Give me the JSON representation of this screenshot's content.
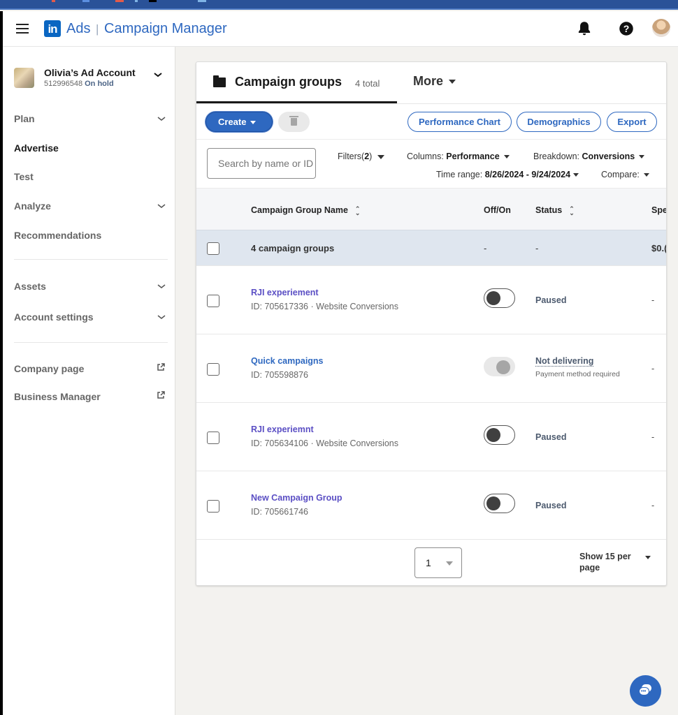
{
  "os_bar": {
    "accent_colors": [
      "#e25b4a",
      "#5b8fe0",
      "#e25b4a",
      "#7fb4e6",
      "#000000",
      "#7fb4e6"
    ]
  },
  "header": {
    "logo_text": "in",
    "app_name": "Ads",
    "separator": "|",
    "product_name": "Campaign Manager",
    "icons": [
      "hamburger-icon",
      "bell-icon",
      "help-icon",
      "avatar"
    ]
  },
  "account": {
    "name": "Olivia’s Ad Account",
    "id": "512996548",
    "status": "On hold"
  },
  "sidebar": {
    "items": [
      {
        "label": "Plan",
        "expandable": true,
        "active": false
      },
      {
        "label": "Advertise",
        "expandable": false,
        "active": true
      },
      {
        "label": "Test",
        "expandable": false,
        "active": false
      },
      {
        "label": "Analyze",
        "expandable": true,
        "active": false
      },
      {
        "label": "Recommendations",
        "expandable": false,
        "active": false
      },
      {
        "label": "Assets",
        "expandable": true,
        "active": false
      },
      {
        "label": "Account settings",
        "expandable": true,
        "active": false
      },
      {
        "label": "Company page",
        "external": true,
        "active": false
      },
      {
        "label": "Business Manager",
        "external": true,
        "active": false
      }
    ]
  },
  "main": {
    "tab_label": "Campaign groups",
    "tab_count": "4 total",
    "more_label": "More",
    "toolbar": {
      "create_label": "Create",
      "performance_chart_label": "Performance Chart",
      "demographics_label": "Demographics",
      "export_label": "Export"
    },
    "search_placeholder": "Search by name or ID",
    "filters": {
      "filters_label": "Filters(",
      "filters_count": "2",
      "filters_close": ")",
      "columns_label": "Columns:",
      "columns_value": "Performance",
      "breakdown_label": "Breakdown:",
      "breakdown_value": "Conversions",
      "time_range_label": "Time range:",
      "time_range_value": "8/26/2024 - 9/24/2024",
      "compare_label": "Compare:"
    },
    "table": {
      "columns": [
        "Campaign Group Name",
        "Off/On",
        "Status",
        "Spe"
      ],
      "summary": {
        "label": "4 campaign groups",
        "off_on": "-",
        "status": "-",
        "spend": "$0.("
      },
      "rows": [
        {
          "name": "RJI experiement",
          "sub": "ID: 705617336 · Website Conversions",
          "toggle": "off",
          "status": "Paused",
          "status_sub": "",
          "spend": "-"
        },
        {
          "name": "Quick campaigns",
          "sub": "ID: 705598876",
          "toggle": "disabled",
          "status": "Not delivering",
          "status_sub": "Payment method required",
          "spend": "-"
        },
        {
          "name": "RJI experiemnt",
          "sub": "ID: 705634106 · Website Conversions",
          "toggle": "off",
          "status": "Paused",
          "status_sub": "",
          "spend": "-"
        },
        {
          "name": "New Campaign Group",
          "sub": "ID: 705661746",
          "toggle": "off",
          "status": "Paused",
          "status_sub": "",
          "spend": "-"
        }
      ]
    },
    "pagination": {
      "page": "1",
      "per_page_label": "Show 15 per page"
    }
  },
  "colors": {
    "brand": "#0a66c2",
    "accent": "#2e68c0",
    "link_purple": "#5b4fc4",
    "os_bar": "#2a5298"
  }
}
